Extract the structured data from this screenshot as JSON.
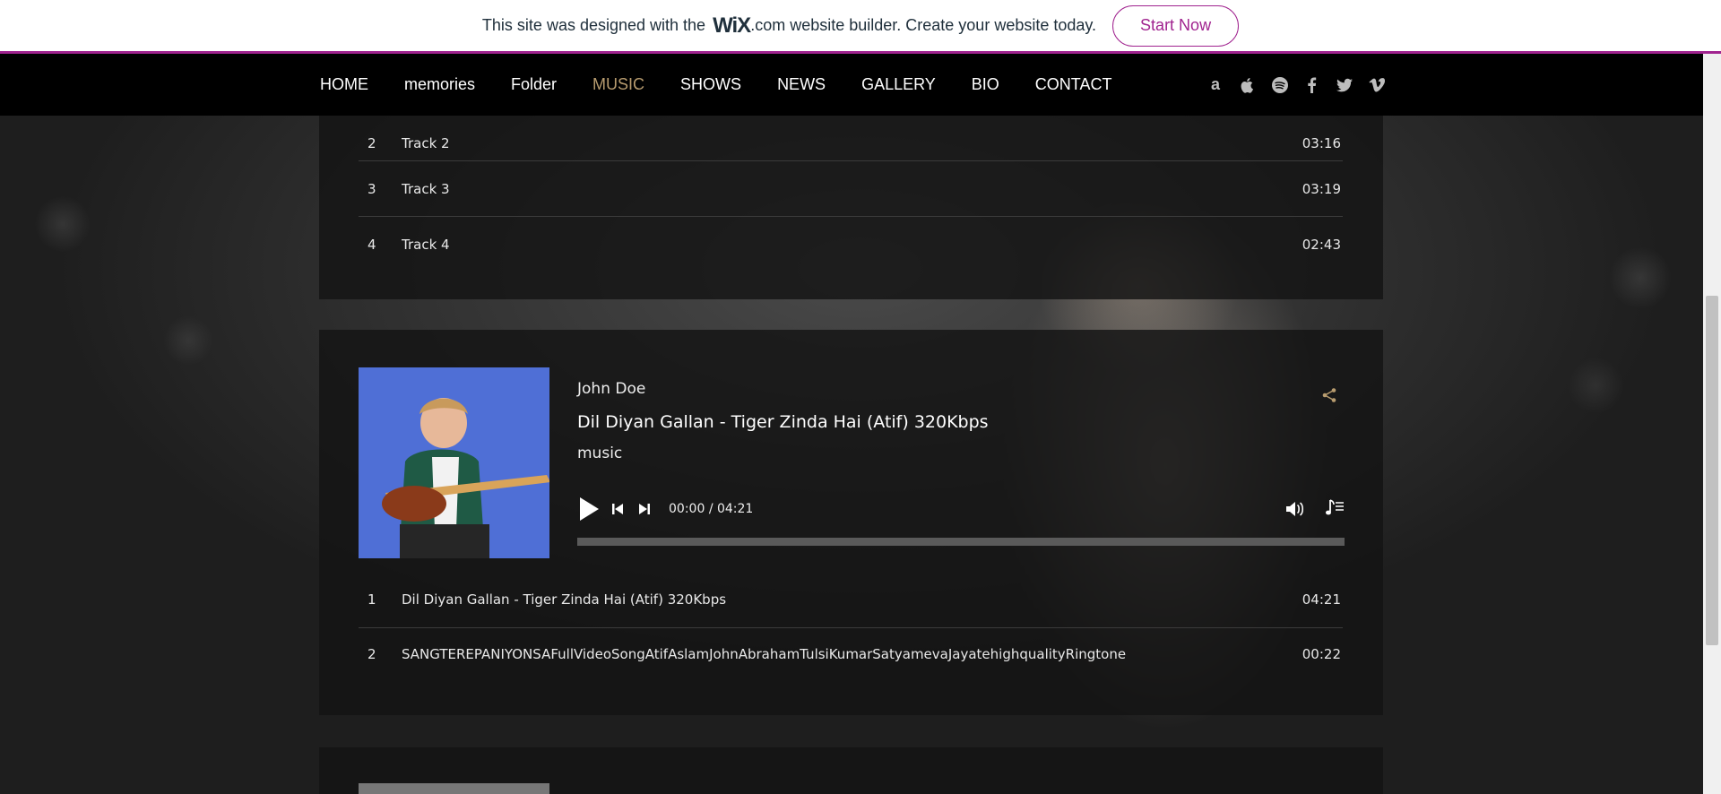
{
  "banner": {
    "text_before": "This site was designed with the",
    "logo": "WiX",
    "text_after": ".com website builder. Create your website today.",
    "cta": "Start Now"
  },
  "nav": {
    "items": [
      "HOME",
      "memories",
      "Folder",
      "MUSIC",
      "SHOWS",
      "NEWS",
      "GALLERY",
      "BIO",
      "CONTACT"
    ],
    "active": "MUSIC",
    "social_icons": [
      "amazon-icon",
      "apple-icon",
      "spotify-icon",
      "facebook-icon",
      "twitter-icon",
      "vimeo-icon"
    ]
  },
  "playlist1": {
    "tracks": [
      {
        "num": "2",
        "title": "Track 2",
        "duration": "03:16"
      },
      {
        "num": "3",
        "title": "Track 3",
        "duration": "03:19"
      },
      {
        "num": "4",
        "title": "Track 4",
        "duration": "02:43"
      }
    ]
  },
  "player": {
    "artist": "John Doe",
    "title": "Dil Diyan Gallan - Tiger Zinda Hai (Atif) 320Kbps",
    "album": "music",
    "current_time": "00:00",
    "separator": "/",
    "total_time": "04:21",
    "progress": 0,
    "tracks": [
      {
        "num": "1",
        "title": "Dil Diyan Gallan - Tiger Zinda Hai (Atif) 320Kbps",
        "duration": "04:21"
      },
      {
        "num": "2",
        "title": "SANGTEREPANIYONSAFullVideoSongAtifAslamJohnAbrahamTulsiKumarSatyamevaJayatehighqualityRingtone",
        "duration": "00:22"
      }
    ]
  },
  "colors": {
    "accent": "#b89c6f",
    "wix_purple": "#a0238f",
    "panel": "#141414"
  }
}
